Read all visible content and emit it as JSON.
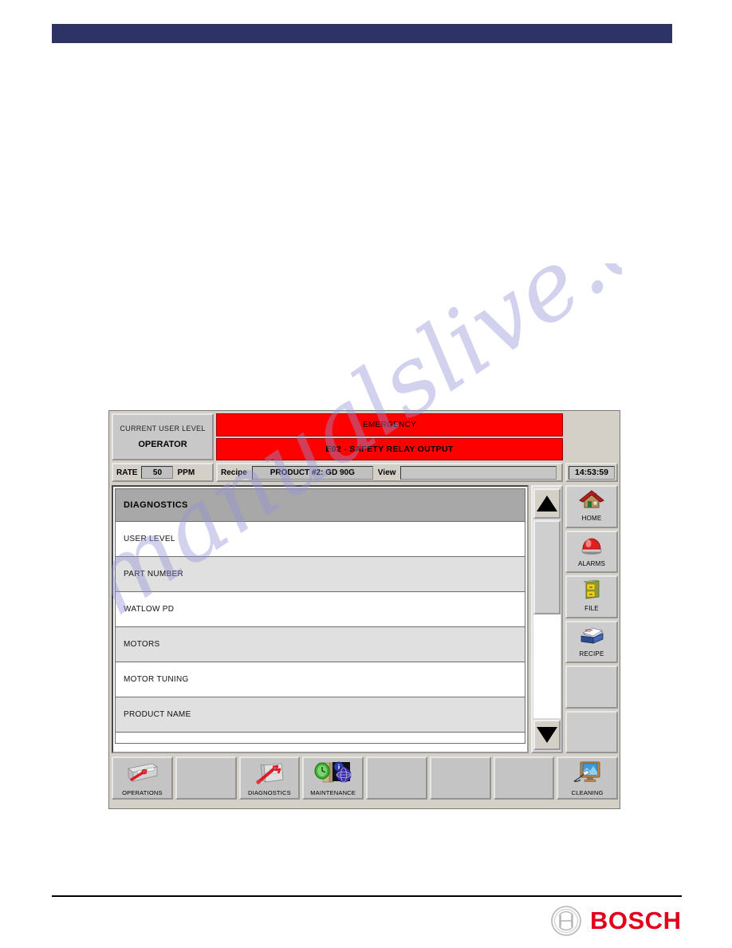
{
  "page": {
    "top_bar_color": "#2e3366",
    "watermark_text": "manualslive.com",
    "brand": "BOSCH",
    "brand_color": "#e2001a"
  },
  "hmi": {
    "status": {
      "user_level_label": "CURRENT USER LEVEL",
      "user_level_value": "OPERATOR",
      "alarm_title": "EMERGENCY",
      "alarm_detail": "E02 - SAFETY RELAY OUTPUT",
      "alarm_color": "#fe0000"
    },
    "rate_bar": {
      "rate_label": "RATE",
      "rate_value": "50",
      "rate_units": "PPM",
      "recipe_label": "Recipe",
      "recipe_value": "PRODUCT #2: GD 90G",
      "view_label": "View",
      "view_value": "",
      "clock": "14:53:59"
    },
    "list": {
      "header": "DIAGNOSTICS",
      "rows": [
        {
          "label": "USER LEVEL"
        },
        {
          "label": "PART NUMBER"
        },
        {
          "label": "WATLOW PD"
        },
        {
          "label": "MOTORS"
        },
        {
          "label": "MOTOR TUNING"
        },
        {
          "label": "PRODUCT NAME"
        }
      ]
    },
    "scrollbar": {
      "up_icon": "triangle-up-icon",
      "down_icon": "triangle-down-icon",
      "thumb_position_percent": 0
    },
    "sidebar": {
      "buttons": [
        {
          "label": "HOME",
          "icon": "house-icon"
        },
        {
          "label": "ALARMS",
          "icon": "alarm-beacon-icon"
        },
        {
          "label": "FILE",
          "icon": "file-cabinet-icon"
        },
        {
          "label": "RECIPE",
          "icon": "recipe-card-box-icon"
        },
        {
          "label": "",
          "icon": ""
        },
        {
          "label": "",
          "icon": ""
        }
      ]
    },
    "toolbar": {
      "buttons": [
        {
          "label": "OPERATIONS",
          "icon": "control-panel-icon"
        },
        {
          "label": "",
          "icon": ""
        },
        {
          "label": "DIAGNOSTICS",
          "icon": "wrench-panel-icon"
        },
        {
          "label": "MAINTENANCE",
          "icon": "maintenance-info-icon"
        },
        {
          "label": "",
          "icon": ""
        },
        {
          "label": "",
          "icon": ""
        },
        {
          "label": "",
          "icon": ""
        },
        {
          "label": "CLEANING",
          "icon": "screen-wipe-icon"
        }
      ]
    }
  }
}
